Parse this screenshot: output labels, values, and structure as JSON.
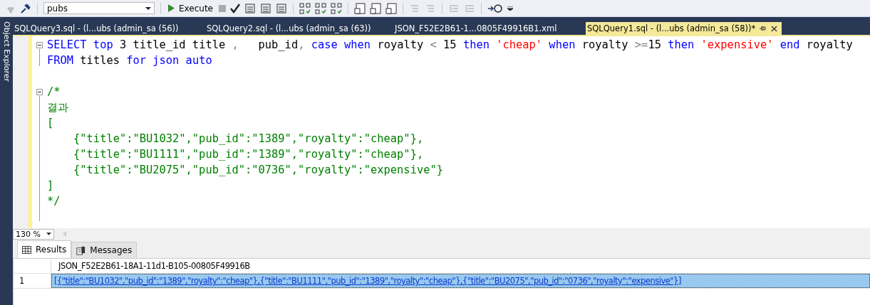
{
  "toolbar": {
    "database": "pubs",
    "execute_label": "Execute"
  },
  "sidebar": {
    "label": "Object Explorer"
  },
  "tabs": [
    {
      "label": "SQLQuery3.sql - (l...ubs (admin_sa (56))",
      "selected": false
    },
    {
      "label": "SQLQuery2.sql - (l...ubs (admin_sa (63))",
      "selected": false
    },
    {
      "label": "JSON_F52E2B61-1...0805F49916B1.xml",
      "selected": false
    },
    {
      "label": "SQLQuery1.sql - (l...ubs (admin_sa (58))*",
      "selected": true
    }
  ],
  "editor": {
    "lines": [
      {
        "kind": "code",
        "tokens": [
          {
            "kind": "keyword",
            "text": "SELECT top "
          },
          {
            "kind": "plain",
            "text": "3 title_id title "
          },
          {
            "kind": "operator",
            "text": ","
          },
          {
            "kind": "plain",
            "text": "   pub_id"
          },
          {
            "kind": "operator",
            "text": ","
          },
          {
            "kind": "keyword",
            "text": " case when"
          },
          {
            "kind": "plain",
            "text": " royalty "
          },
          {
            "kind": "operator",
            "text": "<"
          },
          {
            "kind": "plain",
            "text": " 15 "
          },
          {
            "kind": "keyword",
            "text": "then "
          },
          {
            "kind": "string",
            "text": "'cheap'"
          },
          {
            "kind": "keyword",
            "text": " when"
          },
          {
            "kind": "plain",
            "text": " royalty "
          },
          {
            "kind": "operator",
            "text": ">="
          },
          {
            "kind": "plain",
            "text": "15 "
          },
          {
            "kind": "keyword",
            "text": "then "
          },
          {
            "kind": "string",
            "text": "'expensive'"
          },
          {
            "kind": "keyword",
            "text": " end"
          },
          {
            "kind": "plain",
            "text": " royalty"
          }
        ]
      },
      {
        "kind": "code",
        "tokens": [
          {
            "kind": "keyword",
            "text": "FROM"
          },
          {
            "kind": "plain",
            "text": " titles "
          },
          {
            "kind": "keyword",
            "text": "for json auto"
          }
        ]
      },
      {
        "kind": "blank"
      },
      {
        "kind": "code",
        "tokens": [
          {
            "kind": "comment",
            "text": "/*"
          }
        ]
      },
      {
        "kind": "code",
        "tokens": [
          {
            "kind": "comment",
            "text": "결과"
          }
        ]
      },
      {
        "kind": "code",
        "tokens": [
          {
            "kind": "comment",
            "text": "["
          }
        ]
      },
      {
        "kind": "code",
        "tokens": [
          {
            "kind": "comment",
            "text": "    {\"title\":\"BU1032\",\"pub_id\":\"1389\",\"royalty\":\"cheap\"},"
          }
        ]
      },
      {
        "kind": "code",
        "tokens": [
          {
            "kind": "comment",
            "text": "    {\"title\":\"BU1111\",\"pub_id\":\"1389\",\"royalty\":\"cheap\"},"
          }
        ]
      },
      {
        "kind": "code",
        "tokens": [
          {
            "kind": "comment",
            "text": "    {\"title\":\"BU2075\",\"pub_id\":\"0736\",\"royalty\":\"expensive\"}"
          }
        ]
      },
      {
        "kind": "code",
        "tokens": [
          {
            "kind": "comment",
            "text": "]"
          }
        ]
      },
      {
        "kind": "code",
        "tokens": [
          {
            "kind": "comment",
            "text": "*/"
          }
        ]
      },
      {
        "kind": "blank"
      }
    ],
    "zoom": "130 %"
  },
  "result_tabs": [
    {
      "label": "Results",
      "selected": true
    },
    {
      "label": "Messages",
      "selected": false
    }
  ],
  "grid": {
    "column": "JSON_F52E2B61-18A1-11d1-B105-00805F49916B",
    "rows": [
      {
        "number": "1",
        "value": "[{\"title\":\"BU1032\",\"pub_id\":\"1389\",\"royalty\":\"cheap\"},{\"title\":\"BU1111\",\"pub_id\":\"1389\",\"royalty\":\"cheap\"},{\"title\":\"BU2075\",\"pub_id\":\"0736\",\"royalty\":\"expensive\"}]",
        "selected": true
      }
    ]
  }
}
